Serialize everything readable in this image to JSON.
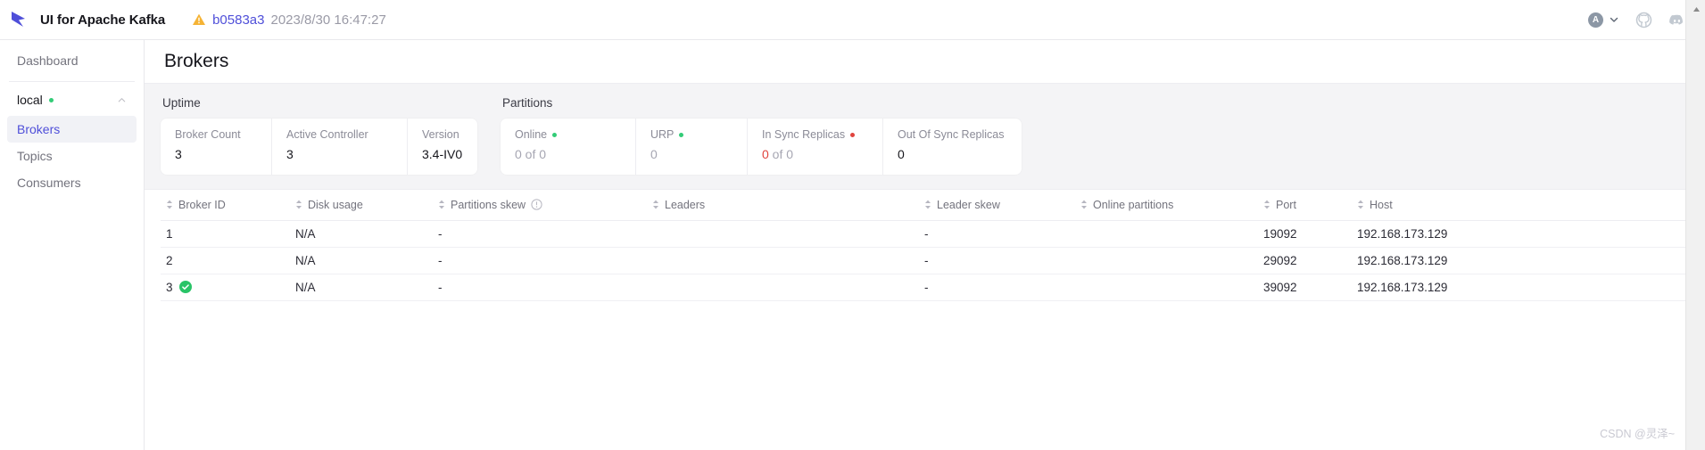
{
  "header": {
    "logo_icon": "kafka-arrow-logo",
    "brand_title": "UI for Apache Kafka",
    "warning_icon": "warning-triangle-icon",
    "commit_hash": "b0583a3",
    "build_time": "2023/8/30 16:47:27",
    "theme_letter": "A",
    "theme_chevron_icon": "chevron-down-icon",
    "github_icon": "github-icon",
    "discord_icon": "discord-icon"
  },
  "sidebar": {
    "dashboard_label": "Dashboard",
    "cluster_name": "local",
    "cluster_status": "online",
    "collapse_icon": "chevron-up-icon",
    "items": [
      {
        "label": "Brokers",
        "active": true
      },
      {
        "label": "Topics",
        "active": false
      },
      {
        "label": "Consumers",
        "active": false
      }
    ]
  },
  "page": {
    "title": "Brokers"
  },
  "metrics": {
    "uptime": {
      "group_label": "Uptime",
      "cells": [
        {
          "label": "Broker Count",
          "value": "3"
        },
        {
          "label": "Active Controller",
          "value": "3"
        },
        {
          "label": "Version",
          "value": "3.4-IV0"
        }
      ]
    },
    "partitions": {
      "group_label": "Partitions",
      "cells": [
        {
          "label": "Online",
          "dot": "green",
          "value_primary": "0",
          "value_suffix": " of 0"
        },
        {
          "label": "URP",
          "dot": "green",
          "value_primary": "0",
          "value_suffix": ""
        },
        {
          "label": "In Sync Replicas",
          "dot": "red",
          "value_primary": "0",
          "value_suffix": " of 0"
        },
        {
          "label": "Out Of Sync Replicas",
          "dot": "none",
          "value_primary": "0",
          "value_suffix": ""
        }
      ]
    }
  },
  "table": {
    "columns": [
      {
        "label": "Broker ID",
        "info": false
      },
      {
        "label": "Disk usage",
        "info": false
      },
      {
        "label": "Partitions skew",
        "info": true
      },
      {
        "label": "Leaders",
        "info": false
      },
      {
        "label": "Leader skew",
        "info": false
      },
      {
        "label": "Online partitions",
        "info": false
      },
      {
        "label": "Port",
        "info": false
      },
      {
        "label": "Host",
        "info": false
      }
    ],
    "rows": [
      {
        "broker_id": "1",
        "controller": false,
        "disk_usage": "N/A",
        "partitions_skew": "-",
        "leaders": "",
        "leader_skew": "-",
        "online_partitions": "",
        "port": "19092",
        "host": "192.168.173.129"
      },
      {
        "broker_id": "2",
        "controller": false,
        "disk_usage": "N/A",
        "partitions_skew": "-",
        "leaders": "",
        "leader_skew": "-",
        "online_partitions": "",
        "port": "29092",
        "host": "192.168.173.129"
      },
      {
        "broker_id": "3",
        "controller": true,
        "disk_usage": "N/A",
        "partitions_skew": "-",
        "leaders": "",
        "leader_skew": "-",
        "online_partitions": "",
        "port": "39092",
        "host": "192.168.173.129"
      }
    ]
  },
  "watermark": "CSDN @灵泽~",
  "colors": {
    "accent": "#4f4fd9",
    "success": "#33cc77",
    "danger": "#e0443e",
    "warning": "#f5b335",
    "bg_muted": "#f4f4f6"
  }
}
